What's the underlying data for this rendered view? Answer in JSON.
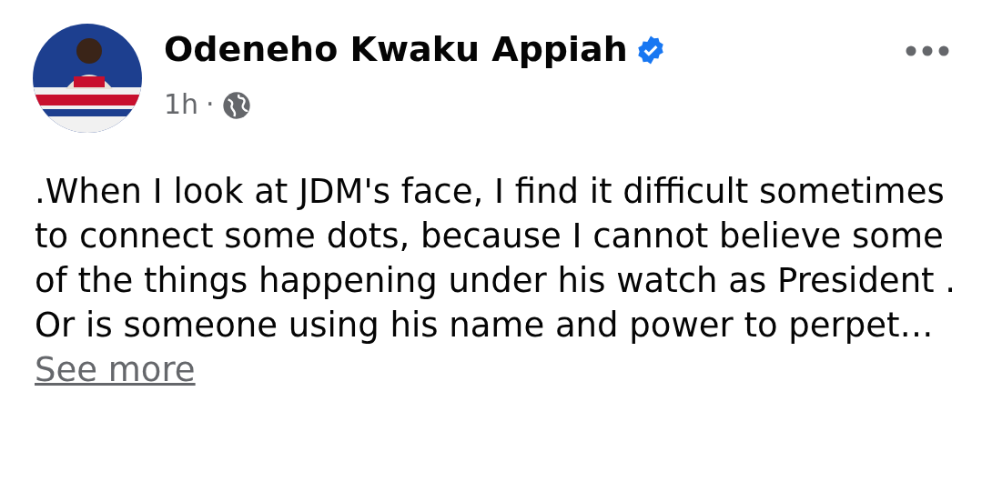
{
  "post": {
    "author": "Odeneho Kwaku Appiah",
    "verified": true,
    "time": "1h",
    "separator": "·",
    "public": true,
    "text": ".When I look at JDM's face, I find it difficult sometimes to connect some dots, because I cannot believe some of the things happening under his watch as President . Or is someone using his name and power to perpet…",
    "see_more": "See more"
  }
}
